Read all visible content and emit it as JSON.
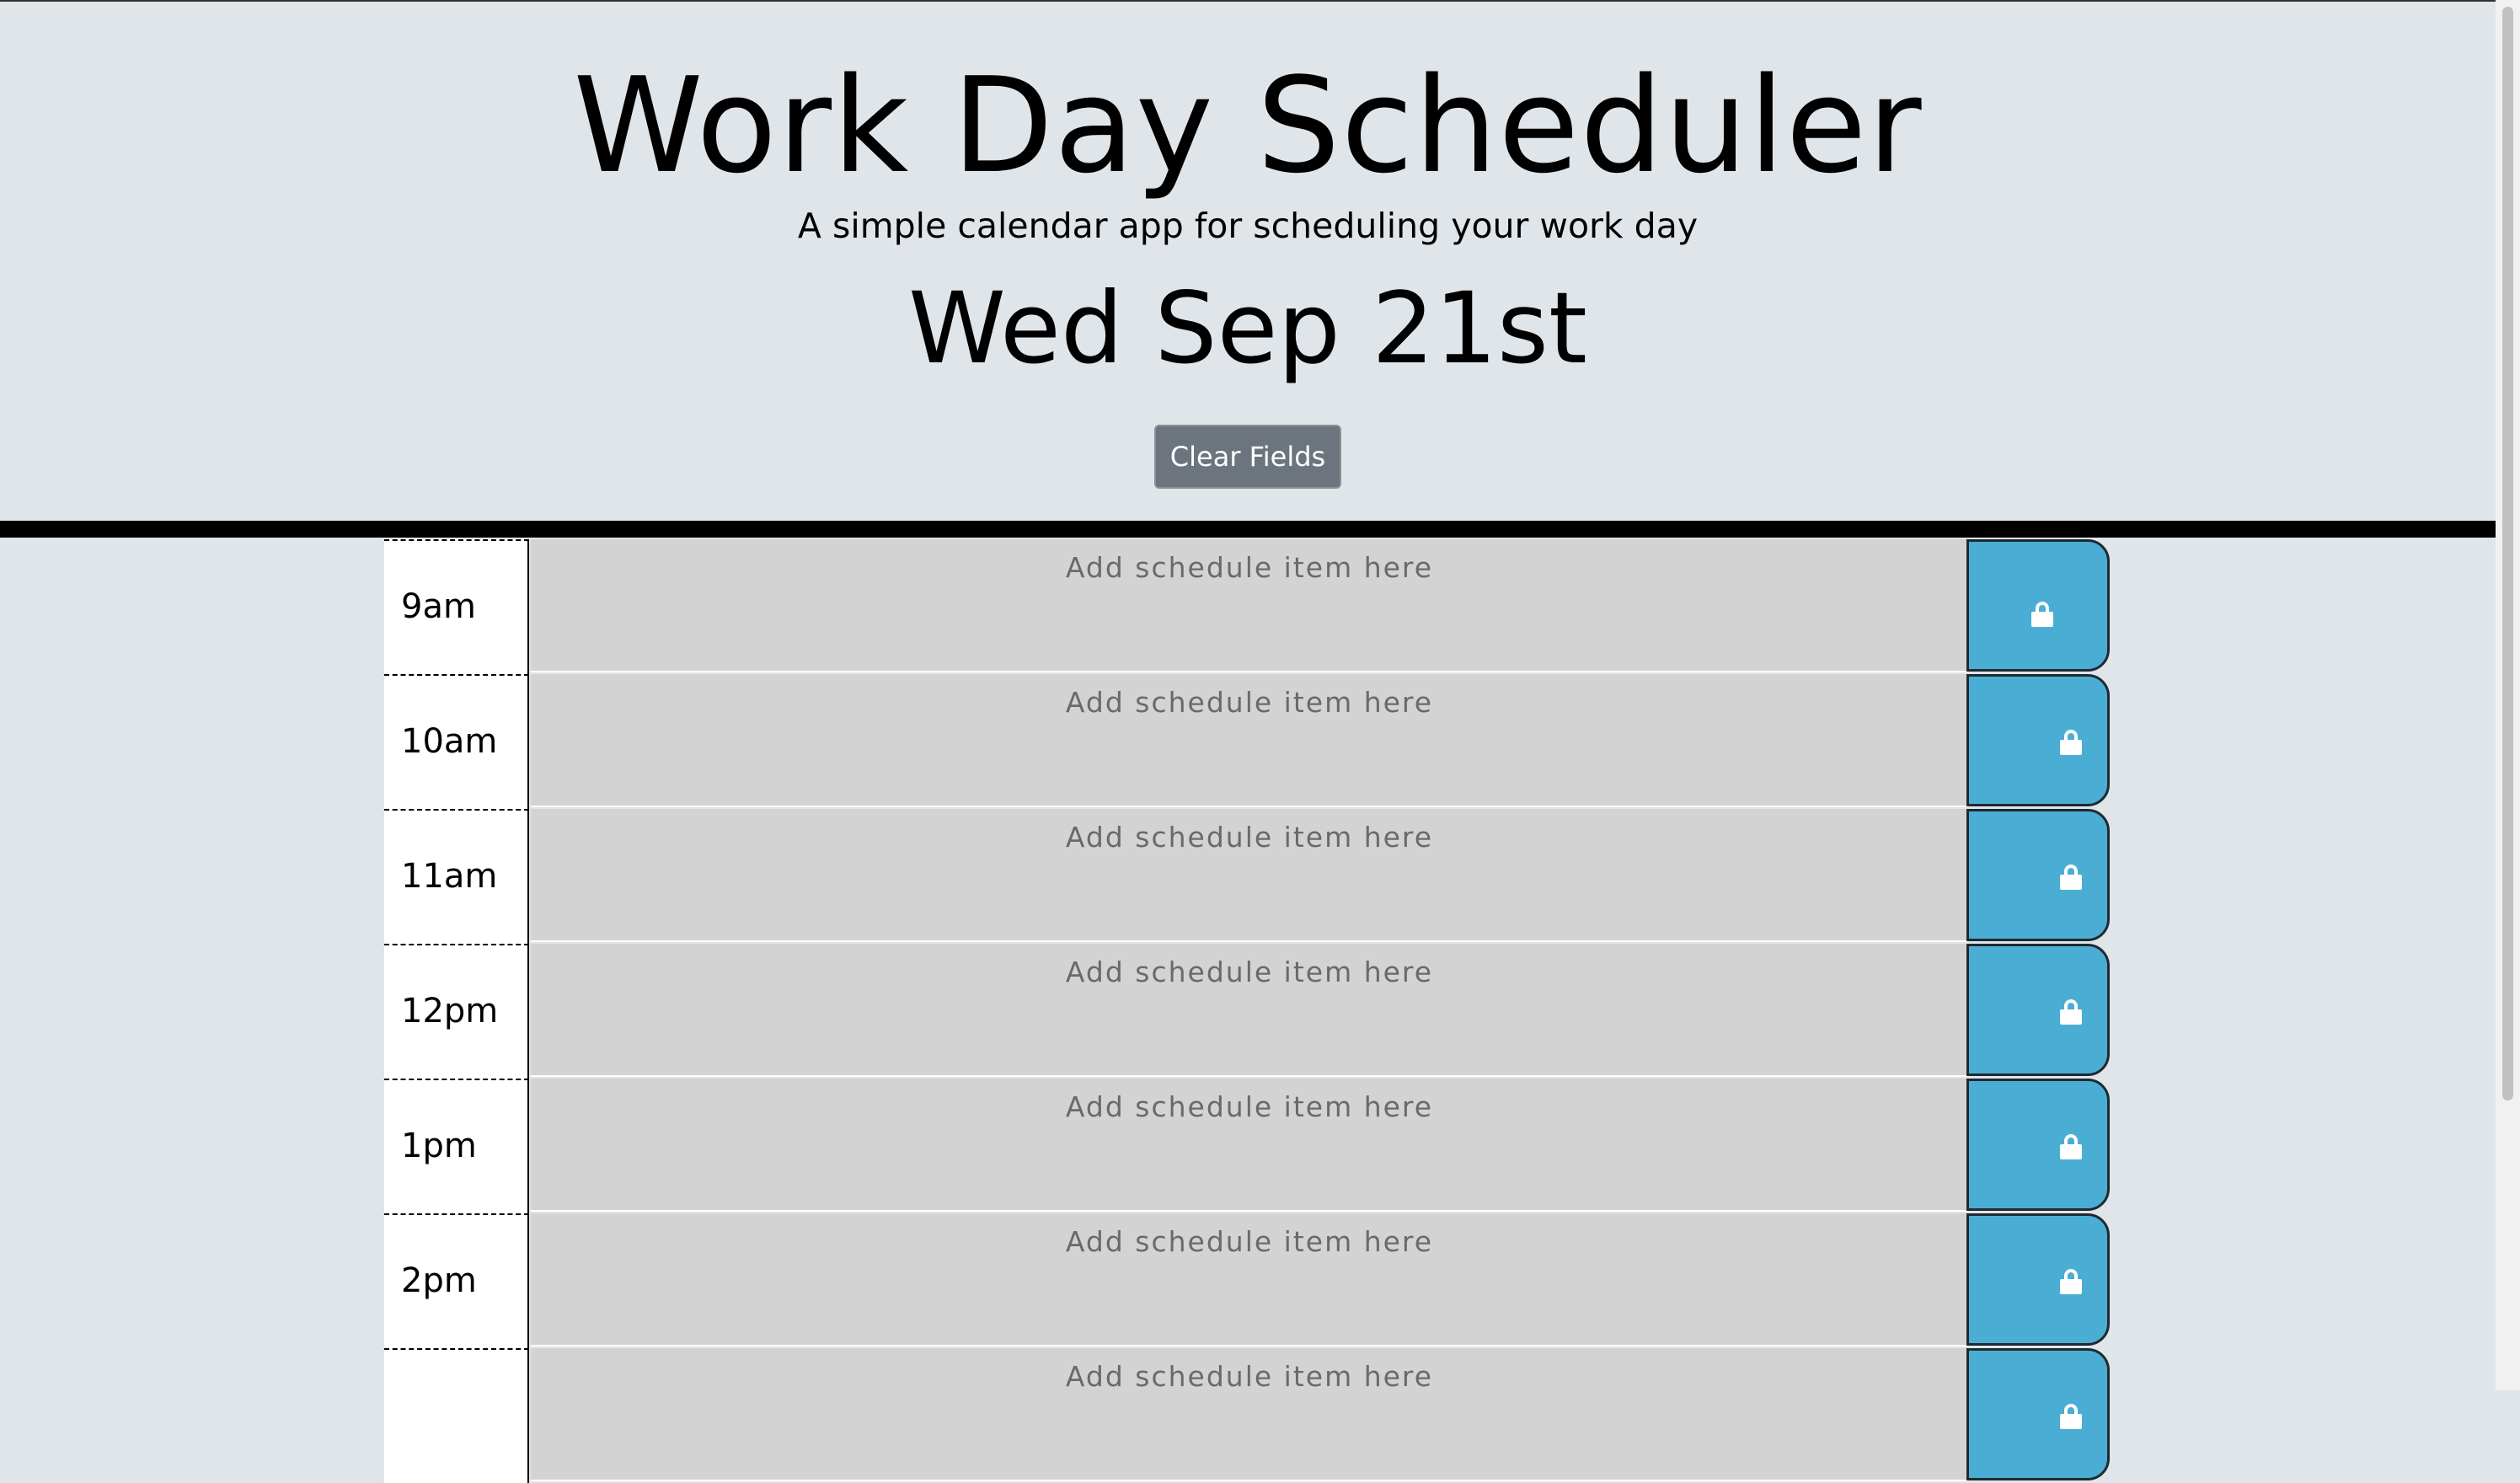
{
  "header": {
    "title": "Work Day Scheduler",
    "subtitle": "A simple calendar app for scheduling your work day",
    "date": "Wed Sep 21st",
    "clear_label": "Clear Fields"
  },
  "schedule": {
    "placeholder": "Add schedule item here",
    "rows": [
      {
        "hour": "9am",
        "value": ""
      },
      {
        "hour": "10am",
        "value": ""
      },
      {
        "hour": "11am",
        "value": ""
      },
      {
        "hour": "12pm",
        "value": ""
      },
      {
        "hour": "1pm",
        "value": ""
      },
      {
        "hour": "2pm",
        "value": ""
      },
      {
        "hour": "",
        "value": ""
      }
    ]
  },
  "icons": {
    "save": "lock-icon"
  },
  "colors": {
    "save_button": "#4aaed4",
    "description_bg": "#d3d3d3",
    "clear_button": "#6c757d",
    "page_bg": "#e0e5ea"
  }
}
